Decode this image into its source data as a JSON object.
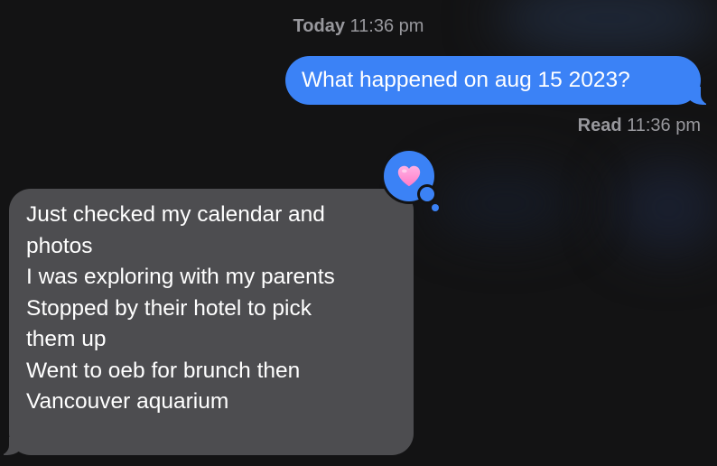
{
  "header": {
    "day": "Today",
    "time": "11:36 pm"
  },
  "outgoing": {
    "text": "What happened on aug 15 2023?",
    "color": "#3b82f6"
  },
  "receipt": {
    "label": "Read",
    "time": "11:36 pm"
  },
  "tapback": {
    "icon": "heart-icon",
    "heart_color": "#ff8fd6",
    "bubble_color": "#3b82f6"
  },
  "incoming": {
    "color": "#4d4d50",
    "lines": [
      "Just checked my calendar and",
      "photos",
      "I was exploring with my parents",
      "Stopped by their hotel to pick",
      "them up",
      "Went to oeb for brunch then",
      "Vancouver aquarium"
    ]
  },
  "colors": {
    "background": "#131314",
    "meta_text": "#98989d"
  }
}
